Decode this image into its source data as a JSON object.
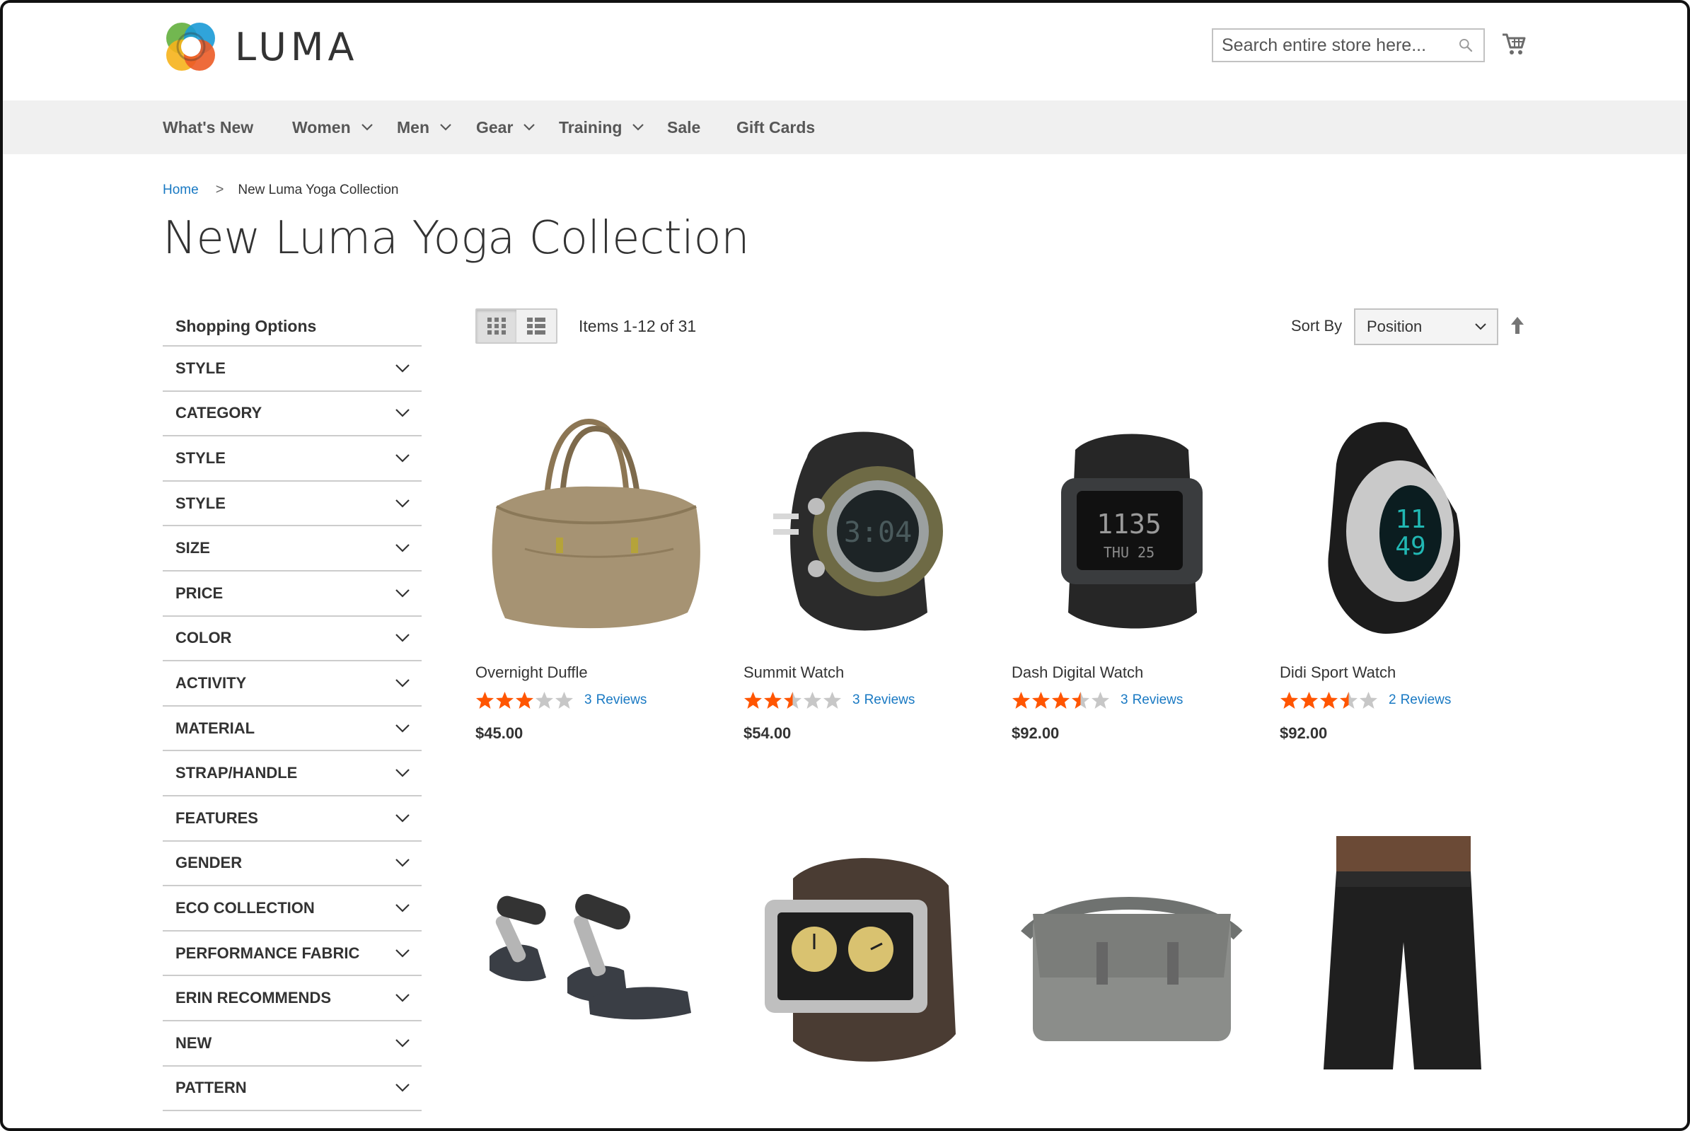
{
  "brand": {
    "name": "LUMA"
  },
  "search": {
    "placeholder": "Search entire store here..."
  },
  "nav": [
    {
      "label": "What's New",
      "dropdown": false
    },
    {
      "label": "Women",
      "dropdown": true
    },
    {
      "label": "Men",
      "dropdown": true
    },
    {
      "label": "Gear",
      "dropdown": true
    },
    {
      "label": "Training",
      "dropdown": true
    },
    {
      "label": "Sale",
      "dropdown": false
    },
    {
      "label": "Gift Cards",
      "dropdown": false
    }
  ],
  "breadcrumb": {
    "home": "Home",
    "separator": ">",
    "current": "New Luma Yoga Collection"
  },
  "page_title": "New Luma Yoga Collection",
  "sidebar": {
    "title": "Shopping Options",
    "filters": [
      "STYLE",
      "CATEGORY",
      "STYLE",
      "STYLE",
      "SIZE",
      "PRICE",
      "COLOR",
      "ACTIVITY",
      "MATERIAL",
      "STRAP/HANDLE",
      "FEATURES",
      "GENDER",
      "ECO COLLECTION",
      "PERFORMANCE FABRIC",
      "ERIN RECOMMENDS",
      "NEW",
      "PATTERN"
    ]
  },
  "toolbar": {
    "view_modes": [
      "grid",
      "list"
    ],
    "active_mode": "grid",
    "amount": "Items 1-12 of 31",
    "sort_label": "Sort By",
    "sort_value": "Position",
    "sort_direction": "ascending"
  },
  "products": [
    {
      "name": "Overnight Duffle",
      "rating": 3,
      "review_count": "3",
      "review_label": "Reviews",
      "price": "$45.00",
      "image": "duffle-bag"
    },
    {
      "name": "Summit Watch",
      "rating": 2.5,
      "review_count": "3",
      "review_label": "Reviews",
      "price": "$54.00",
      "image": "summit-watch"
    },
    {
      "name": "Dash Digital Watch",
      "rating": 3.5,
      "review_count": "3",
      "review_label": "Reviews",
      "price": "$92.00",
      "image": "digital-watch"
    },
    {
      "name": "Didi Sport Watch",
      "rating": 3.5,
      "review_count": "2",
      "review_label": "Reviews",
      "price": "$92.00",
      "image": "sport-watch"
    },
    {
      "name": "",
      "image": "push-up-grips"
    },
    {
      "name": "",
      "image": "analog-watch"
    },
    {
      "name": "",
      "image": "messenger-bag"
    },
    {
      "name": "",
      "image": "training-pants"
    }
  ],
  "colors": {
    "accent_link": "#1979c3",
    "star": "#ff5501",
    "star_empty": "#c7c7c7",
    "nav_bg": "#f0f0f0"
  }
}
